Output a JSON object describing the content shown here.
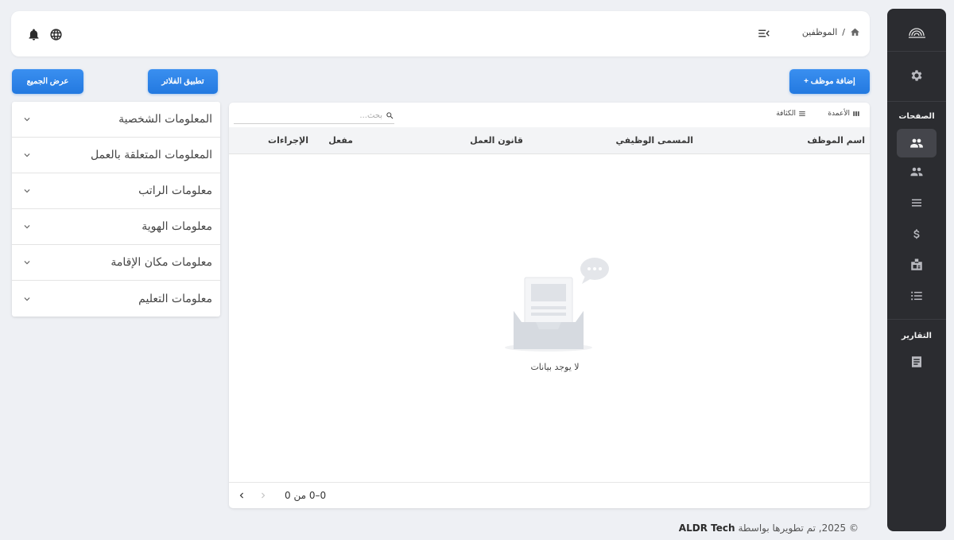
{
  "header": {
    "breadcrumb_current": "الموظفين",
    "breadcrumb_separator": "/"
  },
  "actions": {
    "add_employee": "+ إضافة موظف",
    "apply_filters": "تطبيق الفلاتر",
    "show_all": "عرض الجميع"
  },
  "sidebar": {
    "section_pages": "الصفحات",
    "section_reports": "التقارير"
  },
  "filters": [
    {
      "label": "المعلومات الشخصية"
    },
    {
      "label": "المعلومات المتعلقة بالعمل"
    },
    {
      "label": "معلومات الراتب"
    },
    {
      "label": "معلومات الهوية"
    },
    {
      "label": "معلومات مكان الإقامة"
    },
    {
      "label": "معلومات التعليم"
    }
  ],
  "table": {
    "toolbar": {
      "columns": "الأعمدة",
      "density": "الكثافة",
      "search_placeholder": "بحث..."
    },
    "columns": [
      "اسم الموظف",
      "المسمى الوظيفي",
      "قانون العمل",
      "مفعل",
      "الإجراءات"
    ],
    "empty_text": "لا يوجد بيانات",
    "pagination": "0–0 من 0"
  },
  "footer": {
    "text": "© 2025, تم تطويرها بواسطة",
    "brand": "ALDR Tech"
  },
  "colors": {
    "primary": "#2379e0",
    "sidebar_bg": "#2b2c30",
    "page_bg": "#eef0f4"
  }
}
